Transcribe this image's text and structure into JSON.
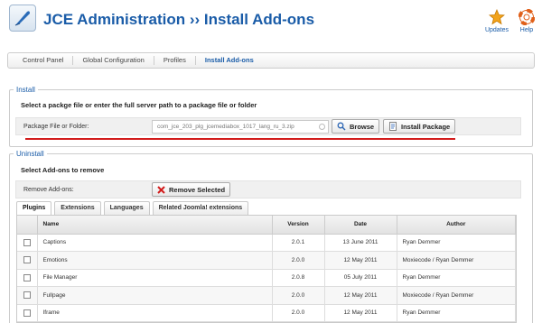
{
  "header": {
    "title": "JCE Administration ›› Install Add-ons",
    "updates_label": "Updates",
    "help_label": "Help",
    "updates_icon": "star-icon",
    "help_icon": "lifebuoy-icon"
  },
  "nav": {
    "tabs": [
      {
        "label": "Control Panel"
      },
      {
        "label": "Global Configuration"
      },
      {
        "label": "Profiles"
      },
      {
        "label": "Install Add-ons"
      }
    ],
    "active": "Install Add-ons"
  },
  "install": {
    "legend": "Install",
    "instruction": "Select a packge file or enter the full server path to a package file or folder",
    "field_label": "Package File or Folder:",
    "field_value": "com_jce_203_plg_jcemediabox_1017_lang_ru_3.zip",
    "browse_label": "Browse",
    "install_label": "Install Package"
  },
  "uninstall": {
    "legend": "Uninstall",
    "instruction": "Select Add-ons to remove",
    "field_label": "Remove Add-ons:",
    "remove_label": "Remove Selected",
    "tabs": [
      {
        "label": "Plugins"
      },
      {
        "label": "Extensions"
      },
      {
        "label": "Languages"
      },
      {
        "label": "Related Joomla! extensions"
      }
    ],
    "active_tab": "Plugins"
  },
  "table": {
    "headers": {
      "name": "Name",
      "version": "Version",
      "date": "Date",
      "author": "Author"
    },
    "rows": [
      {
        "name": "Captions",
        "version": "2.0.1",
        "date": "13 June 2011",
        "author": "Ryan Demmer"
      },
      {
        "name": "Emotions",
        "version": "2.0.0",
        "date": "12 May 2011",
        "author": "Moxiecode / Ryan Demmer"
      },
      {
        "name": "File Manager",
        "version": "2.0.8",
        "date": "05 July 2011",
        "author": "Ryan Demmer"
      },
      {
        "name": "Fullpage",
        "version": "2.0.0",
        "date": "12 May 2011",
        "author": "Moxiecode / Ryan Demmer"
      },
      {
        "name": "Iframe",
        "version": "2.0.0",
        "date": "12 May 2011",
        "author": "Ryan Demmer"
      }
    ]
  },
  "colors": {
    "title_blue": "#1a5ca8",
    "highlight_red": "#d21c1c"
  }
}
